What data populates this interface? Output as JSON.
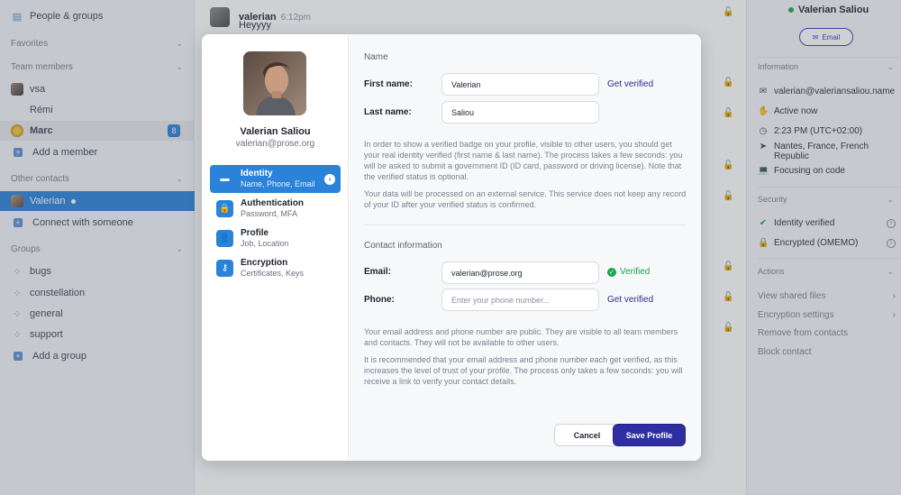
{
  "sidebar": {
    "top_item": "People & groups",
    "favorites_label": "Favorites",
    "team_members_label": "Team members",
    "team_members": [
      {
        "name": "vsa"
      },
      {
        "name": "Rémi"
      },
      {
        "name": "Marc",
        "badge": "8"
      }
    ],
    "add_member_label": "Add a member",
    "other_contacts_label": "Other contacts",
    "other_contacts": [
      {
        "name": "Valerian"
      }
    ],
    "connect_label": "Connect with someone",
    "groups_label": "Groups",
    "groups": [
      "bugs",
      "constellation",
      "general",
      "support"
    ],
    "add_group_label": "Add a group"
  },
  "chat": {
    "author": "valerian",
    "time": "6:12pm",
    "text": "Heyyyy"
  },
  "right_panel": {
    "name": "Valerian Saliou",
    "email_button": "Email",
    "information_label": "Information",
    "email": "valerian@valeriansaliou.name",
    "presence": "Active now",
    "local_time": "2:23 PM (UTC+02:00)",
    "location": "Nantes, France, French Republic",
    "activity": "Focusing on code",
    "security_label": "Security",
    "identity_verified": "Identity verified",
    "encrypted": "Encrypted (OMEMO)",
    "actions_label": "Actions",
    "actions": [
      "View shared files",
      "Encryption settings",
      "Remove from contacts",
      "Block contact"
    ]
  },
  "modal": {
    "profile_name": "Valerian Saliou",
    "profile_email": "valerian@prose.org",
    "nav": [
      {
        "title": "Identity",
        "subtitle": "Name, Phone, Email"
      },
      {
        "title": "Authentication",
        "subtitle": "Password, MFA"
      },
      {
        "title": "Profile",
        "subtitle": "Job, Location"
      },
      {
        "title": "Encryption",
        "subtitle": "Certificates, Keys"
      }
    ],
    "name_section": "Name",
    "first_name_label": "First name:",
    "first_name_value": "Valerian",
    "last_name_label": "Last name:",
    "last_name_value": "Saliou",
    "get_verified": "Get verified",
    "identity_para_1": "In order to show a verified badge on your profile, visible to other users, you should get your real identity verified (first name & last name). The process takes a few seconds: you will be asked to submit a government ID (ID card, password or driving license). Note that the verified status is optional.",
    "identity_para_2": "Your data will be processed on an external service. This service does not keep any record of your ID after your verified status is confirmed.",
    "contact_section": "Contact information",
    "email_label": "Email:",
    "email_value": "valerian@prose.org",
    "verified_label": "Verified",
    "phone_label": "Phone:",
    "phone_placeholder": "Enter your phone number...",
    "phone_get_verified": "Get verified",
    "contact_para_1": "Your email address and phone number are public. They are visible to all team members and contacts. They will not be available to other users.",
    "contact_para_2": "It is recommended that your email address and phone number each get verified, as this increases the level of trust of your profile. The process only takes a few seconds: you will receive a link to verify your contact details.",
    "cancel_label": "Cancel",
    "save_label": "Save Profile"
  },
  "colors": {
    "accent": "#2a83d8",
    "primary_button": "#2d2ea1",
    "verified_green": "#1aa84a",
    "lock_red": "#c4283a"
  }
}
